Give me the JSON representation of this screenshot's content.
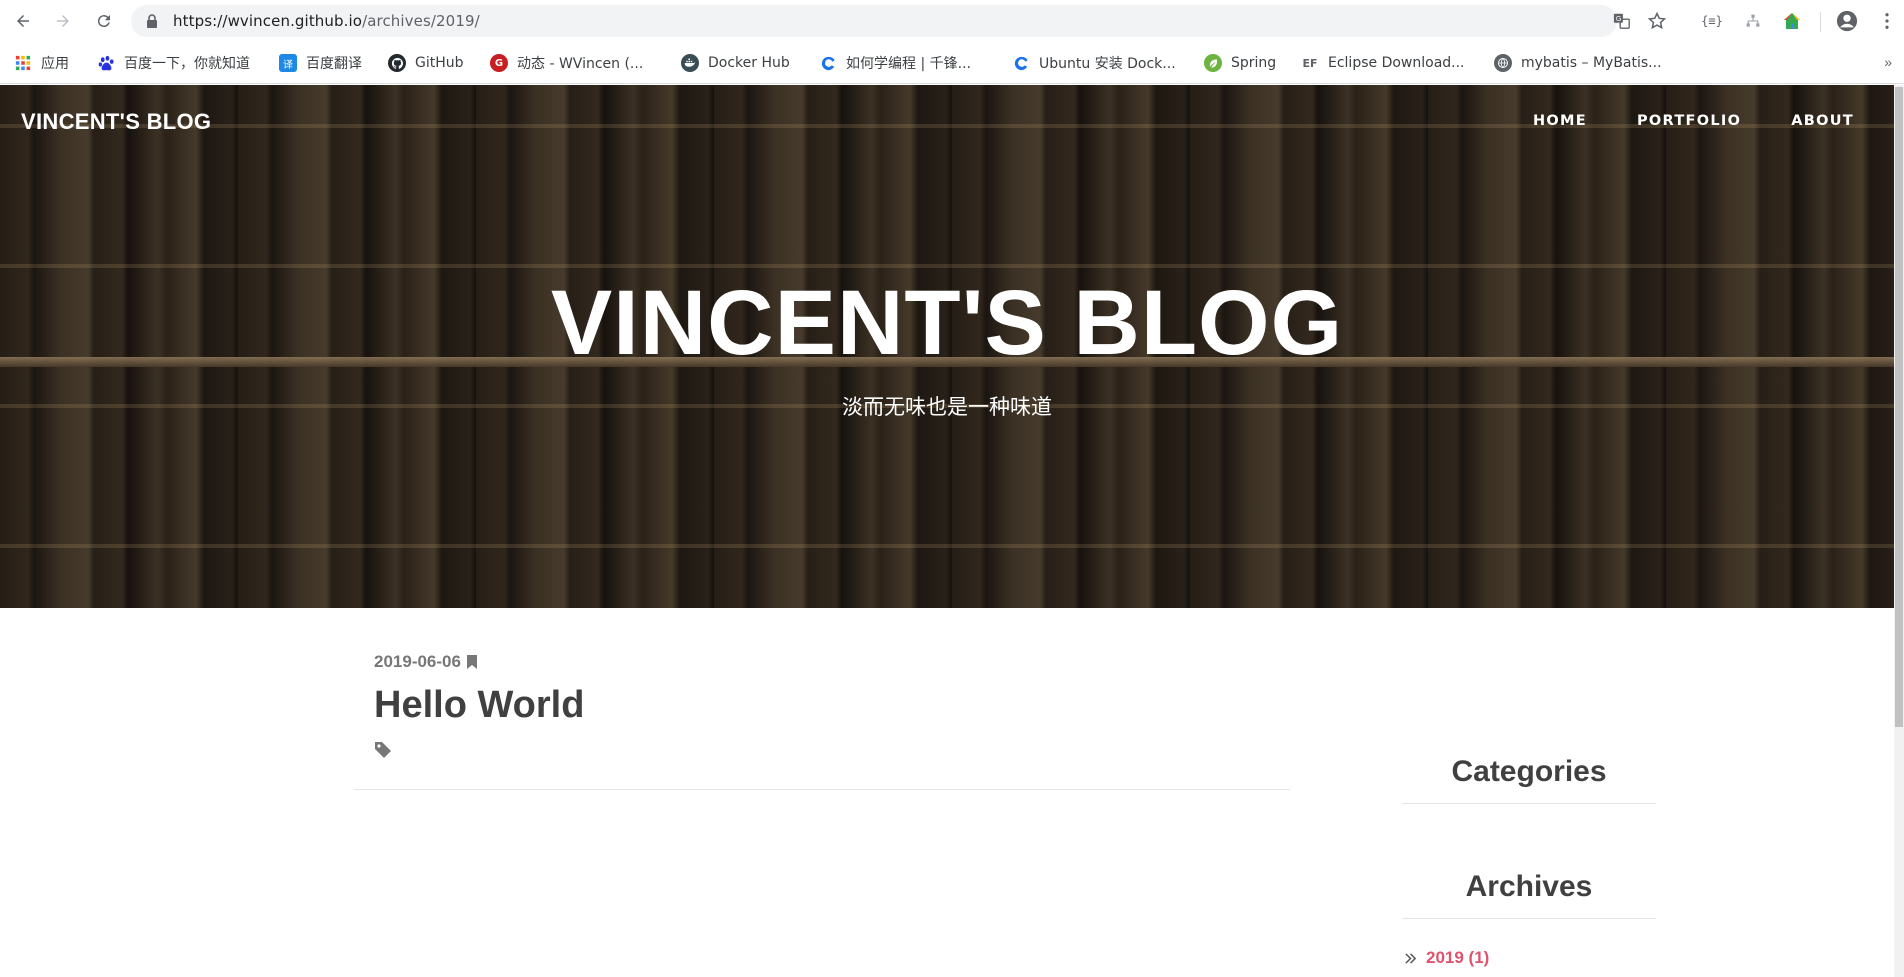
{
  "browser": {
    "url_host": "https://wvincen.github.io",
    "url_path": "/archives/2019/",
    "bookmarks": [
      {
        "label": "应用",
        "icon": "apps-grid-icon",
        "color": "#ea4335"
      },
      {
        "label": "百度一下，你就知道",
        "icon": "baidu-paw-icon",
        "color": "#2932e1"
      },
      {
        "label": "百度翻译",
        "icon": "baidu-translate-icon",
        "color": "#1e88e5"
      },
      {
        "label": "GitHub",
        "icon": "github-icon",
        "color": "#24292e"
      },
      {
        "label": "动态 - WVincen (...",
        "icon": "gitee-icon",
        "color": "#c71d23"
      },
      {
        "label": "Docker Hub",
        "icon": "docker-icon",
        "color": "#394d54"
      },
      {
        "label": "如何学编程 | 千锋...",
        "icon": "qfeng-icon",
        "color": "#1a73e8"
      },
      {
        "label": "Ubuntu 安装 Dock...",
        "icon": "qfeng-icon",
        "color": "#1a73e8"
      },
      {
        "label": "Spring",
        "icon": "spring-leaf-icon",
        "color": "#6db33f"
      },
      {
        "label": "Eclipse Download...",
        "icon": "eclipse-ef-icon",
        "color": "#ffffff"
      },
      {
        "label": "mybatis – MyBatis...",
        "icon": "globe-icon",
        "color": "#5f6368"
      }
    ],
    "more_label": "»"
  },
  "header": {
    "logo": "VINCENT'S BLOG",
    "nav": [
      "HOME",
      "PORTFOLIO",
      "ABOUT"
    ]
  },
  "hero": {
    "title": "VINCENT'S BLOG",
    "subtitle": "淡而无味也是一种味道"
  },
  "post": {
    "date": "2019-06-06",
    "title": "Hello World"
  },
  "sidebar": {
    "categories_heading": "Categories",
    "archives_heading": "Archives",
    "archive_link": "2019 (1)"
  },
  "colors": {
    "accent": "#e0536f"
  }
}
